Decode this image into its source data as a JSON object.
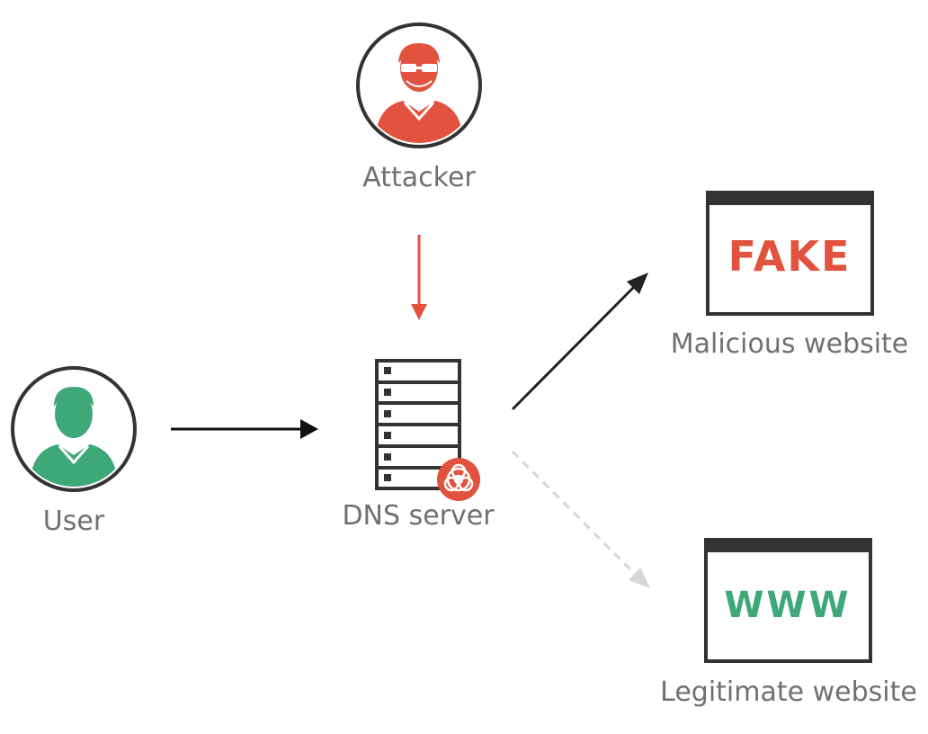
{
  "nodes": {
    "attacker": {
      "label": "Attacker"
    },
    "user": {
      "label": "User"
    },
    "dns_server": {
      "label": "DNS server"
    },
    "malicious_site": {
      "label": "Malicious website",
      "screen_text": "FAKE"
    },
    "legitimate_site": {
      "label": "Legitimate website",
      "screen_text": "WWW"
    }
  },
  "edges": [
    {
      "from": "attacker",
      "to": "dns_server",
      "style": "solid",
      "color": "#e2533f"
    },
    {
      "from": "user",
      "to": "dns_server",
      "style": "solid",
      "color": "#111111"
    },
    {
      "from": "dns_server",
      "to": "malicious_site",
      "style": "solid",
      "color": "#222222"
    },
    {
      "from": "dns_server",
      "to": "legitimate_site",
      "style": "dashed",
      "color": "#d6d6d6"
    }
  ],
  "icons": {
    "attacker": "hacker-person-icon",
    "user": "person-icon",
    "dns_server": "server-rack-icon",
    "biohazard": "biohazard-icon",
    "malicious_site": "browser-window-icon",
    "legitimate_site": "browser-window-icon"
  },
  "colors": {
    "red": "#e2533f",
    "green": "#3fa878",
    "outline": "#333333",
    "label_gray": "#707070",
    "dashed_gray": "#d6d6d6"
  }
}
